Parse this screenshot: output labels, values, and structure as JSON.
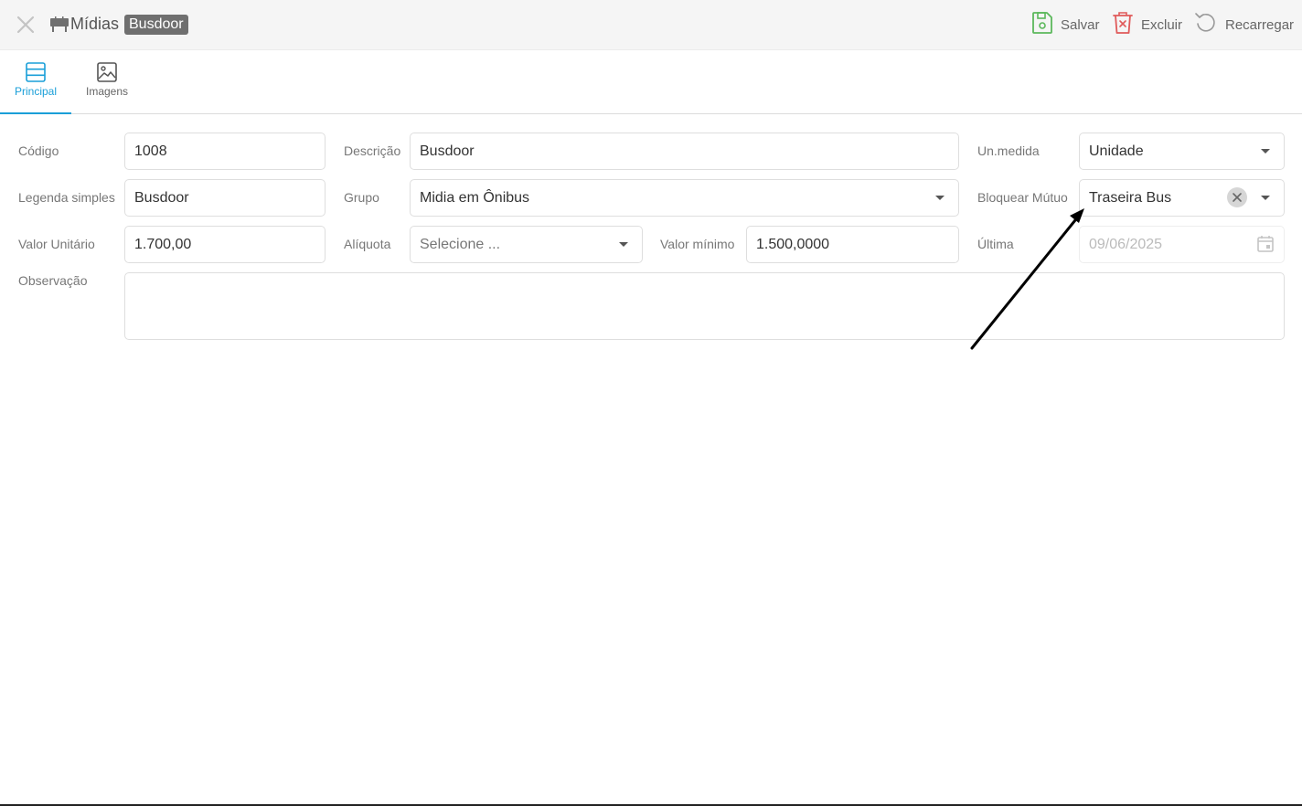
{
  "header": {
    "module_title": "Mídias",
    "record_badge": "Busdoor",
    "actions": {
      "save": "Salvar",
      "delete": "Excluir",
      "reload": "Recarregar"
    }
  },
  "tabs": [
    {
      "label": "Principal",
      "icon": "list-icon",
      "active": true
    },
    {
      "label": "Imagens",
      "icon": "image-icon",
      "active": false
    }
  ],
  "form": {
    "codigo": {
      "label": "Código",
      "value": "1008"
    },
    "descricao": {
      "label": "Descrição",
      "value": "Busdoor"
    },
    "un_medida": {
      "label": "Un.medida",
      "value": "Unidade"
    },
    "legenda": {
      "label": "Legenda simples",
      "value": "Busdoor"
    },
    "grupo": {
      "label": "Grupo",
      "value": "Midia em Ônibus"
    },
    "bloquear": {
      "label": "Bloquear Mútuo",
      "value": "Traseira Bus"
    },
    "valor_unitario": {
      "label": "Valor Unitário",
      "value": "1.700,00"
    },
    "aliquota": {
      "label": "Alíquota",
      "placeholder": "Selecione ..."
    },
    "valor_minimo": {
      "label": "Valor mínimo",
      "value": "1.500,0000"
    },
    "ultima": {
      "label": "Última",
      "value": "09/06/2025"
    },
    "observacao": {
      "label": "Observação",
      "value": ""
    }
  },
  "colors": {
    "accent": "#1a9fd8",
    "save": "#5cb85c",
    "delete": "#e05a5a",
    "header_bg": "#f5f5f5"
  }
}
